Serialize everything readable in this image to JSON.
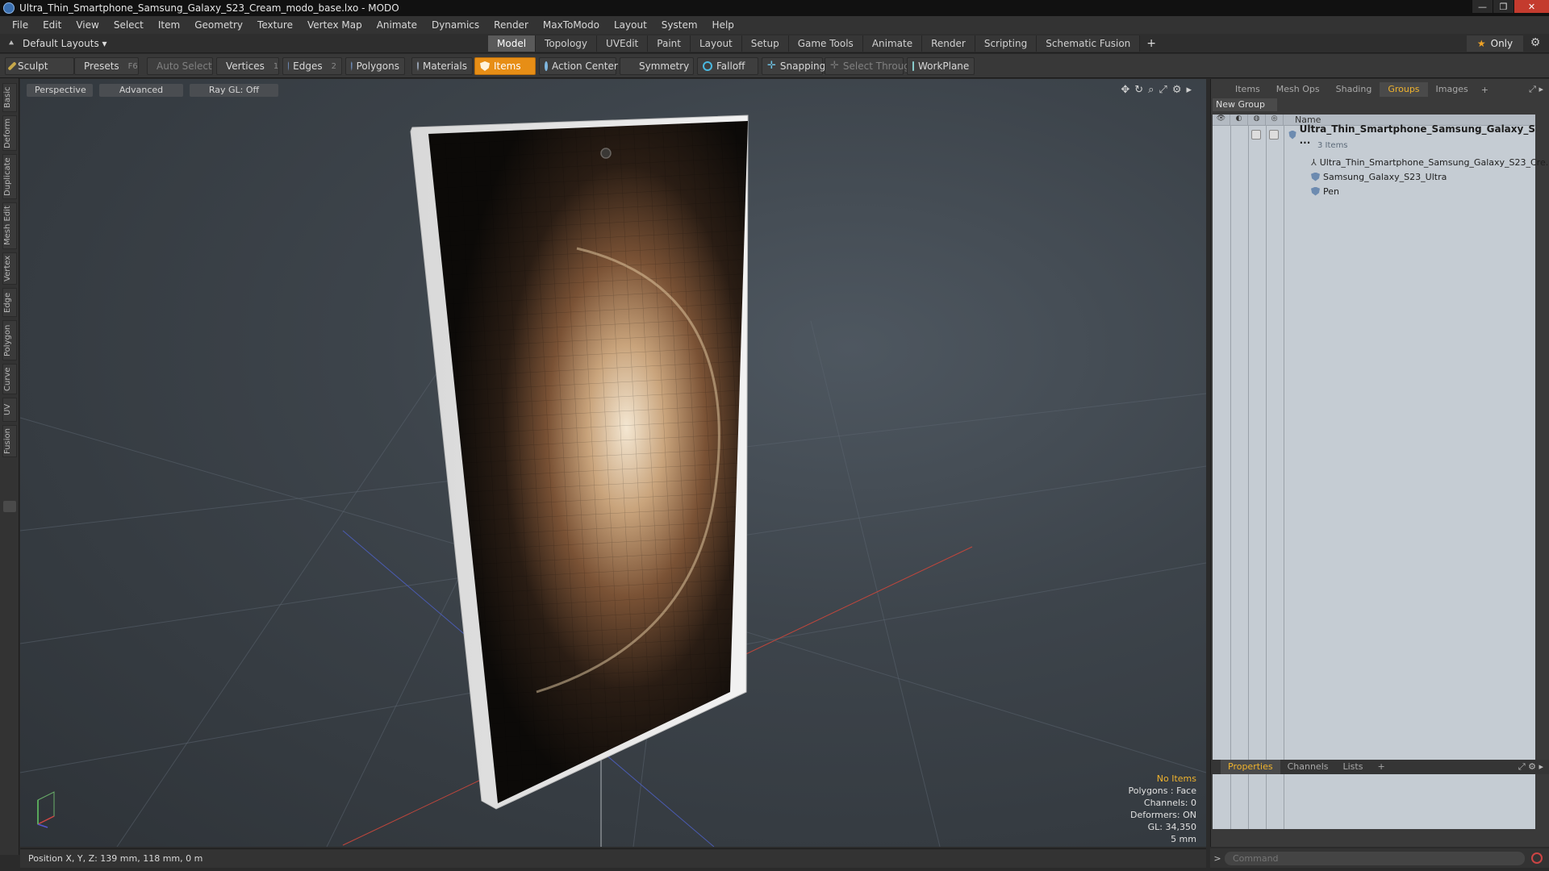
{
  "window": {
    "title": "Ultra_Thin_Smartphone_Samsung_Galaxy_S23_Cream_modo_base.lxo - MODO",
    "btn_min": "—",
    "btn_max": "❐",
    "btn_close": "✕"
  },
  "menu": [
    "File",
    "Edit",
    "View",
    "Select",
    "Item",
    "Geometry",
    "Texture",
    "Vertex Map",
    "Animate",
    "Dynamics",
    "Render",
    "MaxToModo",
    "Layout",
    "System",
    "Help"
  ],
  "layoutbar": {
    "layout_dropdown": "Default Layouts ▾",
    "tabs": [
      "Model",
      "Topology",
      "UVEdit",
      "Paint",
      "Layout",
      "Setup",
      "Game Tools",
      "Animate",
      "Render",
      "Scripting",
      "Schematic Fusion"
    ],
    "active_tab": "Model",
    "plus": "+",
    "only_label": "Only",
    "star": "★",
    "gear": "⚙"
  },
  "toolbar": {
    "sculpt": "Sculpt",
    "presets": "Presets",
    "presets_key": "F6",
    "auto_select": "Auto Select",
    "vertices": "Vertices",
    "vertices_key": "1",
    "edges": "Edges",
    "edges_key": "2",
    "polygons": "Polygons",
    "materials": "Materials",
    "items": "Items",
    "action_center": "Action Center",
    "symmetry": "Symmetry",
    "falloff": "Falloff",
    "snapping": "Snapping",
    "select_through": "Select Through",
    "workplane": "WorkPlane"
  },
  "left_tabs": [
    "Basic",
    "Deform",
    "Duplicate",
    "Mesh Edit",
    "Vertex",
    "Edge",
    "Polygon",
    "Curve",
    "UV",
    "Fusion"
  ],
  "viewport": {
    "view_mode": "Perspective",
    "shading": "Advanced",
    "raygl": "Ray GL: Off",
    "info": {
      "selection": "No Items",
      "polygons": "Polygons : Face",
      "channels": "Channels: 0",
      "deformers": "Deformers: ON",
      "gl": "GL: 34,350",
      "scale": "5 mm"
    }
  },
  "right_panel": {
    "tabs": [
      "Items",
      "Mesh Ops",
      "Shading",
      "Groups",
      "Images"
    ],
    "active_tab": "Groups",
    "plus": "+",
    "new_group": "New Group",
    "name_header": "Name",
    "group_name": "Ultra_Thin_Smartphone_Samsung_Galaxy_S ...",
    "group_count": "3 Items",
    "items": [
      "Ultra_Thin_Smartphone_Samsung_Galaxy_S23_Cre...",
      "Samsung_Galaxy_S23_Ultra",
      "Pen"
    ]
  },
  "bottom_panel": {
    "tabs": [
      "Properties",
      "Channels",
      "Lists"
    ],
    "active_tab": "Properties",
    "plus": "+"
  },
  "status": {
    "position": "Position X, Y, Z:  139 mm, 118 mm, 0 m"
  },
  "command": {
    "placeholder": "Command",
    "caret": ">"
  },
  "colors": {
    "accent": "#e78e16",
    "active_tab_text": "#f0b32d",
    "viewport_bg": "#3d444b"
  }
}
